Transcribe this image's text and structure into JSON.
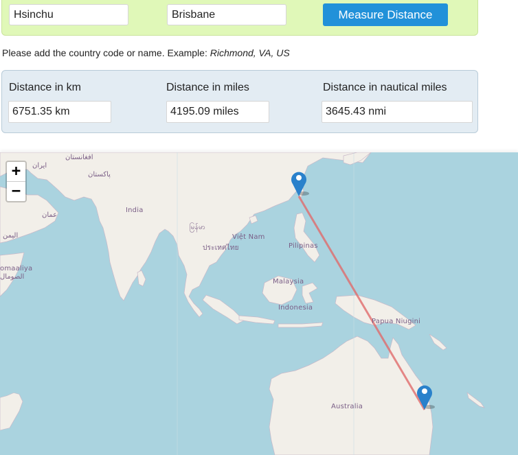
{
  "search": {
    "from_value": "Hsinchu",
    "to_value": "Brisbane",
    "button_label": "Measure Distance"
  },
  "hint": {
    "text": "Please add the country code or name. Example: ",
    "example": "Richmond, VA, US"
  },
  "results": {
    "km_label": "Distance in km",
    "km_value": "6751.35 km",
    "miles_label": "Distance in miles",
    "miles_value": "4195.09 miles",
    "nmi_label": "Distance in nautical miles",
    "nmi_value": "3645.43 nmi"
  },
  "map": {
    "zoom_in": "+",
    "zoom_out": "−",
    "route_color": "#e06c6c",
    "marker_color": "#2a81cb",
    "markers": [
      "Hsinchu",
      "Brisbane"
    ],
    "labels": {
      "iran": "ایران",
      "afghanistan": "افغانستان",
      "pakistan": "پاکستان",
      "india": "India",
      "oman": "عمان",
      "yemen": "اليمن",
      "somalia_latin": "omaaliya",
      "somalia_arabic": "الصومال",
      "myanmar": "မြန်မာ",
      "vietnam": "Việt Nam",
      "thailand": "ประเทศไทย",
      "philippines": "Pilipinas",
      "malaysia": "Malaysia",
      "indonesia": "Indonesia",
      "png": "Papua Niugini",
      "australia": "Australia"
    }
  }
}
